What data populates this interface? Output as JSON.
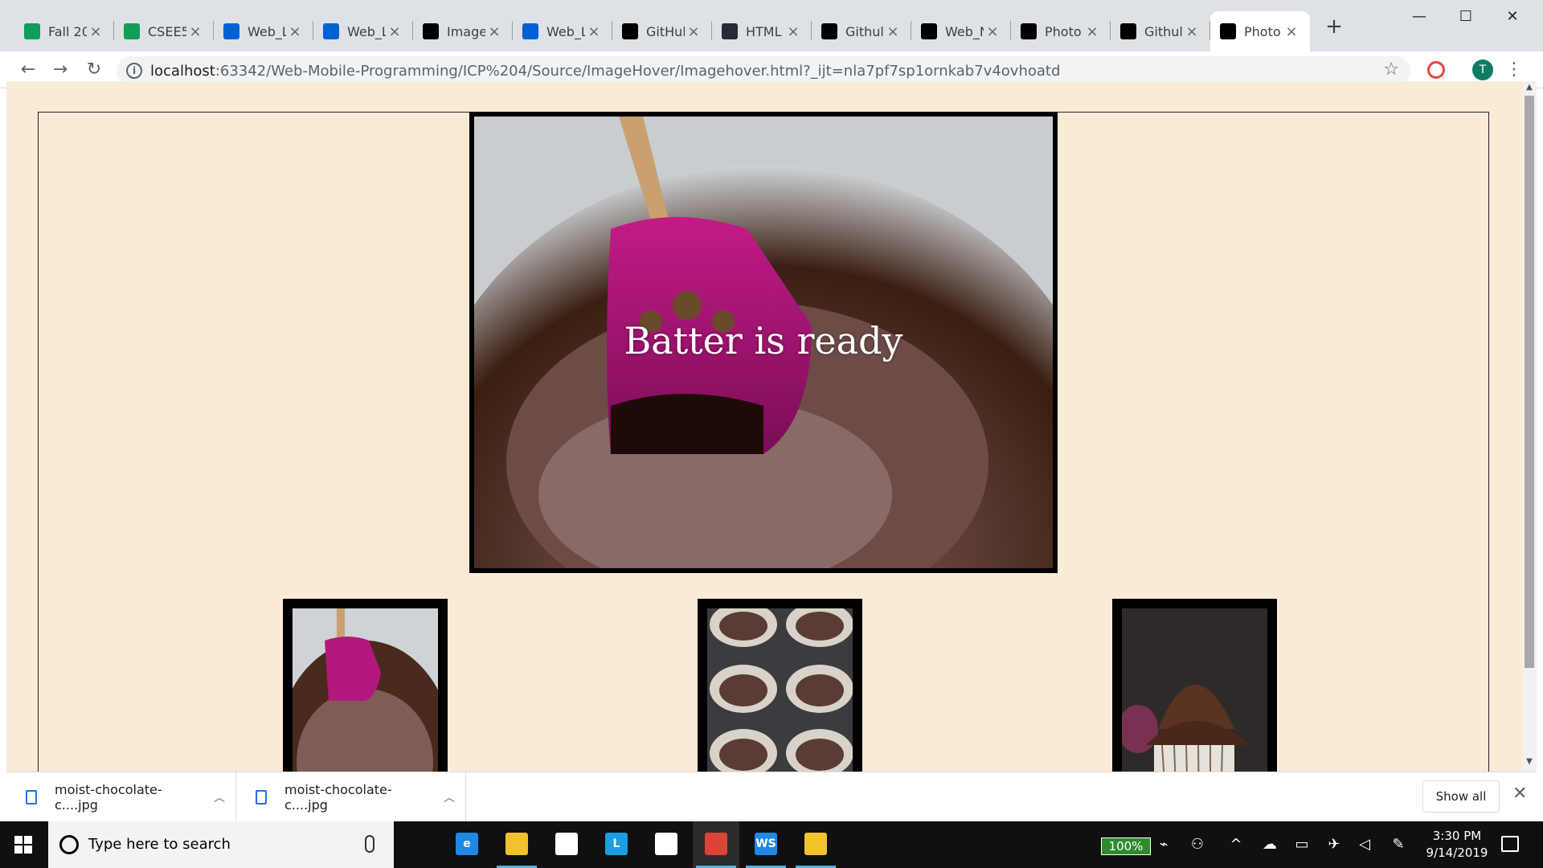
{
  "tabs": [
    {
      "title": "Fall 20",
      "icon": "sheets-icon",
      "color": "#0f9d58"
    },
    {
      "title": "CSEE5",
      "icon": "sheets-icon",
      "color": "#0f9d58"
    },
    {
      "title": "Web_L",
      "icon": "box-icon",
      "color": "#0061d5"
    },
    {
      "title": "Web_L",
      "icon": "box-icon",
      "color": "#0061d5"
    },
    {
      "title": "Image",
      "icon": "codepen-icon",
      "color": "#000000"
    },
    {
      "title": "Web_L",
      "icon": "box-icon",
      "color": "#0061d5"
    },
    {
      "title": "GitHul",
      "icon": "github-icon",
      "color": "#000000"
    },
    {
      "title": "HTML",
      "icon": "w3-icon",
      "color": "#282a35"
    },
    {
      "title": "Githul",
      "icon": "webstorm-icon",
      "color": "#000000"
    },
    {
      "title": "Web_N",
      "icon": "github-icon",
      "color": "#000000"
    },
    {
      "title": "Photo",
      "icon": "webstorm-icon",
      "color": "#000000"
    },
    {
      "title": "Githul",
      "icon": "webstorm-icon",
      "color": "#000000"
    },
    {
      "title": "Photo",
      "icon": "webstorm-icon",
      "color": "#000000",
      "active": true
    }
  ],
  "window": {
    "minimize": "—",
    "maximize": "☐",
    "close": "✕",
    "new_tab": "+"
  },
  "nav": {
    "back": "←",
    "forward": "→",
    "reload": "↻"
  },
  "address": {
    "host": "localhost",
    "path": ":63342/Web-Mobile-Programming/ICP%204/Source/ImageHover/Imagehover.html?_ijt=nla7pf7sp1ornkab7v4ovhoatd"
  },
  "profile": {
    "initial": "T",
    "color": "#0f7b63"
  },
  "page": {
    "background": "#faebd7",
    "main_caption": "Batter is ready",
    "thumbnails": [
      "batter-thumbnail",
      "muffin-tin-thumbnail",
      "cupcake-thumbnail"
    ]
  },
  "downloads": {
    "items": [
      {
        "name": "moist-chocolate-c....jpg"
      },
      {
        "name": "moist-chocolate-c....jpg"
      }
    ],
    "show_all": "Show all"
  },
  "taskbar": {
    "search_placeholder": "Type here to search",
    "battery": "100%",
    "time": "3:30 PM",
    "date": "9/14/2019",
    "apps": [
      {
        "name": "task-view-icon",
        "label": "",
        "color": "#101010"
      },
      {
        "name": "edge-icon",
        "label": "e",
        "color": "#1e88e5"
      },
      {
        "name": "file-explorer-icon",
        "label": "",
        "color": "#f2c12e"
      },
      {
        "name": "store-icon",
        "label": "",
        "color": "#ffffff"
      },
      {
        "name": "l-app-icon",
        "label": "L",
        "color": "#1b9ee0"
      },
      {
        "name": "mail-icon",
        "label": "",
        "color": "#ffffff"
      },
      {
        "name": "chrome-icon",
        "label": "",
        "color": "#db4437"
      },
      {
        "name": "webstorm-icon",
        "label": "WS",
        "color": "#1e88e5"
      },
      {
        "name": "sticky-app-icon",
        "label": "",
        "color": "#f2c12e"
      }
    ]
  }
}
